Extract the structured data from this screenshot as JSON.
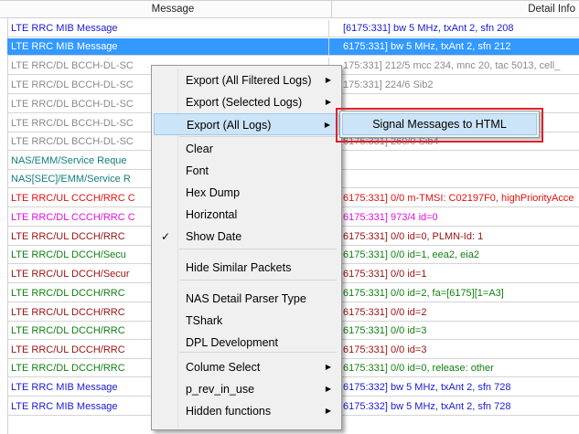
{
  "header": {
    "message": "Message",
    "detail": "Detail Info"
  },
  "colors": {
    "blue": "#1a1ad0",
    "gray": "#8a8a8a",
    "teal": "#137d7d",
    "red": "#e01010",
    "magenta": "#e010e0",
    "darkred": "#9b1010",
    "green": "#118011",
    "selected": "#3399ff"
  },
  "rows": [
    {
      "msg": "LTE RRC MIB Message",
      "detail": "[6175:331] bw 5 MHz, txAnt 2, sfn 208",
      "color": "blue"
    },
    {
      "msg": "LTE RRC MIB Message",
      "detail": "6175:331] bw 5 MHz, txAnt 2, sfn 212",
      "color": "blue",
      "selected": true
    },
    {
      "msg": "LTE RRC/DL BCCH-DL-SC",
      "detail": "175:331] 212/5 mcc 234, mnc 20, tac 5013, cell_",
      "color": "gray"
    },
    {
      "msg": "LTE RRC/DL BCCH-DL-SC",
      "detail": "175:331] 224/6 Sib2",
      "color": "gray"
    },
    {
      "msg": "LTE RRC/DL BCCH-DL-SC",
      "detail": "",
      "color": "gray"
    },
    {
      "msg": "LTE RRC/DL BCCH-DL-SC",
      "detail": "175:331] 258/1 Sib3",
      "color": "gray"
    },
    {
      "msg": "LTE RRC/DL BCCH-DL-SC",
      "detail": "6175:331] 260/0 Sib4",
      "color": "gray"
    },
    {
      "msg": "NAS/EMM/Service Reque",
      "detail": "",
      "color": "teal"
    },
    {
      "msg": "NAS[SEC]/EMM/Service R",
      "detail": "",
      "color": "teal"
    },
    {
      "msg": "LTE RRC/UL CCCH/RRC C",
      "detail": "6175:331] 0/0 m-TMSI: C02197F0, highPriorityAcce",
      "color": "red"
    },
    {
      "msg": "LTE RRC/DL CCCH/RRC C",
      "detail": "6175:331] 973/4 id=0",
      "color": "magenta"
    },
    {
      "msg": "LTE RRC/UL DCCH/RRC",
      "detail": "6175:331] 0/0 id=0, PLMN-Id: 1",
      "color": "darkred"
    },
    {
      "msg": "LTE RRC/DL DCCH/Secu",
      "detail": "6175:331] 0/0 id=1, eea2, eia2",
      "color": "green"
    },
    {
      "msg": "LTE RRC/UL DCCH/Secur",
      "detail": "6175:331] 0/0 id=1",
      "color": "darkred"
    },
    {
      "msg": "LTE RRC/DL DCCH/RRC",
      "detail": "6175:331] 0/0 id=2, fa=[6175][1=A3]",
      "color": "green"
    },
    {
      "msg": "LTE RRC/UL DCCH/RRC",
      "detail": "6175:331] 0/0 id=2",
      "color": "darkred"
    },
    {
      "msg": "LTE RRC/DL DCCH/RRC",
      "detail": "6175:331] 0/0 id=3",
      "color": "green"
    },
    {
      "msg": "LTE RRC/UL DCCH/RRC",
      "detail": "6175:331] 0/0 id=3",
      "color": "darkred"
    },
    {
      "msg": "LTE RRC/DL DCCH/RRC",
      "detail": "6175:331] 0/0 id=0, release: other",
      "color": "green"
    },
    {
      "msg": "LTE RRC MIB Message",
      "detail": "6175:332] bw 5 MHz, txAnt 2, sfn 728",
      "color": "blue"
    },
    {
      "msg": "LTE RRC MIB Message",
      "detail": "6175:332] bw 5 MHz, txAnt 2, sfn 728",
      "color": "blue"
    }
  ],
  "menu": {
    "items": [
      {
        "label": "Export (All Filtered Logs)",
        "submenu": true
      },
      {
        "label": "Export (Selected Logs)",
        "submenu": true
      },
      {
        "label": "Export (All Logs)",
        "submenu": true,
        "highlighted": true
      },
      {
        "label": "Clear"
      },
      {
        "label": "Font"
      },
      {
        "label": "Hex Dump"
      },
      {
        "label": "Horizontal"
      },
      {
        "label": "Show Date",
        "checked": true
      },
      {
        "label": "Hide Similar Packets"
      },
      {
        "label": "NAS Detail Parser Type"
      },
      {
        "label": "TShark"
      },
      {
        "label": "DPL Development"
      },
      {
        "label": "Colume Select",
        "submenu": true
      },
      {
        "label": "p_rev_in_use",
        "submenu": true
      },
      {
        "label": "Hidden functions",
        "submenu": true
      }
    ],
    "check_glyph": "✓",
    "arrow_glyph": "▶"
  },
  "submenu": {
    "item": "Signal Messages to HTML"
  }
}
